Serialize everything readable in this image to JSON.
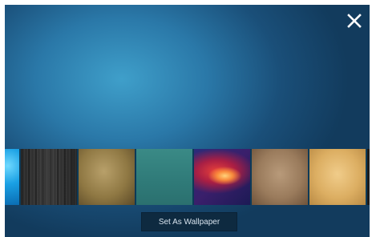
{
  "header": {
    "close_icon": "close-icon"
  },
  "wallpapers": [
    {
      "name": "blue-water-texture"
    },
    {
      "name": "dark-wood-texture"
    },
    {
      "name": "tan-fabric-texture"
    },
    {
      "name": "teal-solid"
    },
    {
      "name": "red-nebula"
    },
    {
      "name": "aged-paper-texture"
    },
    {
      "name": "parchment-texture"
    }
  ],
  "actions": {
    "set_wallpaper_label": "Set As Wallpaper"
  },
  "colors": {
    "background_center": "#3f9fca",
    "background_edge": "#123b5d",
    "button_bg": "#0e2a40",
    "button_text": "#d7e3ee"
  }
}
